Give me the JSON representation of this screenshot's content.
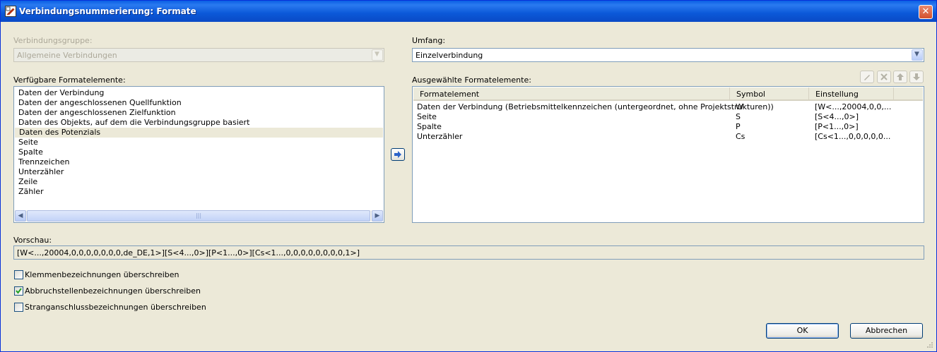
{
  "window": {
    "title": "Verbindungsnummerierung: Formate",
    "close": "✕"
  },
  "group": {
    "label": "Verbindungsgruppe:",
    "value": "Allgemeine Verbindungen"
  },
  "scope": {
    "label": "Umfang:",
    "value": "Einzelverbindung"
  },
  "available": {
    "label": "Verfügbare Formatelemente:",
    "items": [
      "Daten der Verbindung",
      "Daten der angeschlossenen Quellfunktion",
      "Daten der angeschlossenen Zielfunktion",
      "Daten des Objekts, auf dem die Verbindungsgruppe basiert",
      "Daten des Potenzials",
      "Seite",
      "Spalte",
      "Trennzeichen",
      "Unterzähler",
      "Zeile",
      "Zähler"
    ],
    "selected_index": 4,
    "scroll_left": "◀",
    "scroll_right": "▶",
    "scroll_grip": "|||"
  },
  "selected": {
    "label": "Ausgewählte Formatelemente:",
    "columns": [
      "Formatelement",
      "Symbol",
      "Einstellung"
    ],
    "rows": [
      {
        "element": "Daten der Verbindung (Betriebsmittelkennzeichen (untergeordnet, ohne Projektstrukturen))",
        "symbol": "W",
        "setting": "[W<...,20004,0,0,..."
      },
      {
        "element": "Seite",
        "symbol": "S",
        "setting": "[S<4...,0>]"
      },
      {
        "element": "Spalte",
        "symbol": "P",
        "setting": "[P<1...,0>]"
      },
      {
        "element": "Unterzähler",
        "symbol": "Cs",
        "setting": "[Cs<1...,0,0,0,0,0..."
      }
    ]
  },
  "preview": {
    "label": "Vorschau:",
    "value": "[W<...,20004,0,0,0,0,0,0,0,de_DE,1>][S<4...,0>][P<1...,0>][Cs<1...,0,0,0,0,0,0,0,0,1>]"
  },
  "options": [
    {
      "label": "Klemmenbezeichnungen überschreiben",
      "checked": false
    },
    {
      "label": "Abbruchstellenbezeichnungen überschreiben",
      "checked": true
    },
    {
      "label": "Stranganschlussbezeichnungen überschreiben",
      "checked": false
    }
  ],
  "buttons": {
    "ok": "OK",
    "cancel": "Abbrechen"
  }
}
